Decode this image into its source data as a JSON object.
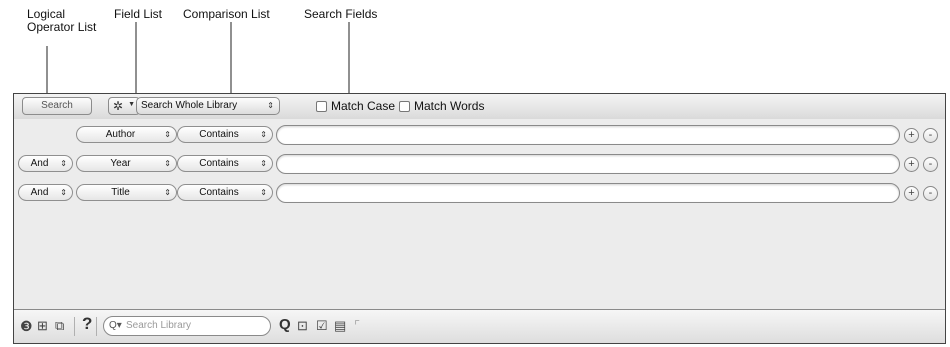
{
  "callouts": {
    "logical_operator_list": "Logical\nOperator List",
    "field_list": "Field List",
    "comparison_list": "Comparison List",
    "search_fields": "Search Fields"
  },
  "toolbar": {
    "search_button": "Search",
    "options_icon": "gear-icon",
    "scope_select": "Search Whole Library",
    "match_case": "Match Case",
    "match_words": "Match Words"
  },
  "rows": [
    {
      "operator": "",
      "field": "Author",
      "comparison": "Contains",
      "value": ""
    },
    {
      "operator": "And",
      "field": "Year",
      "comparison": "Contains",
      "value": ""
    },
    {
      "operator": "And",
      "field": "Title",
      "comparison": "Contains",
      "value": ""
    }
  ],
  "row_buttons": {
    "add": "+",
    "remove": "-"
  },
  "footer": {
    "search_placeholder": "Search Library",
    "icons": [
      "sync-icon",
      "new-group-icon",
      "copy-group-icon",
      "help-icon",
      "magnifier-icon",
      "import-icon",
      "checklist-icon",
      "document-icon",
      "corner-icon"
    ]
  }
}
